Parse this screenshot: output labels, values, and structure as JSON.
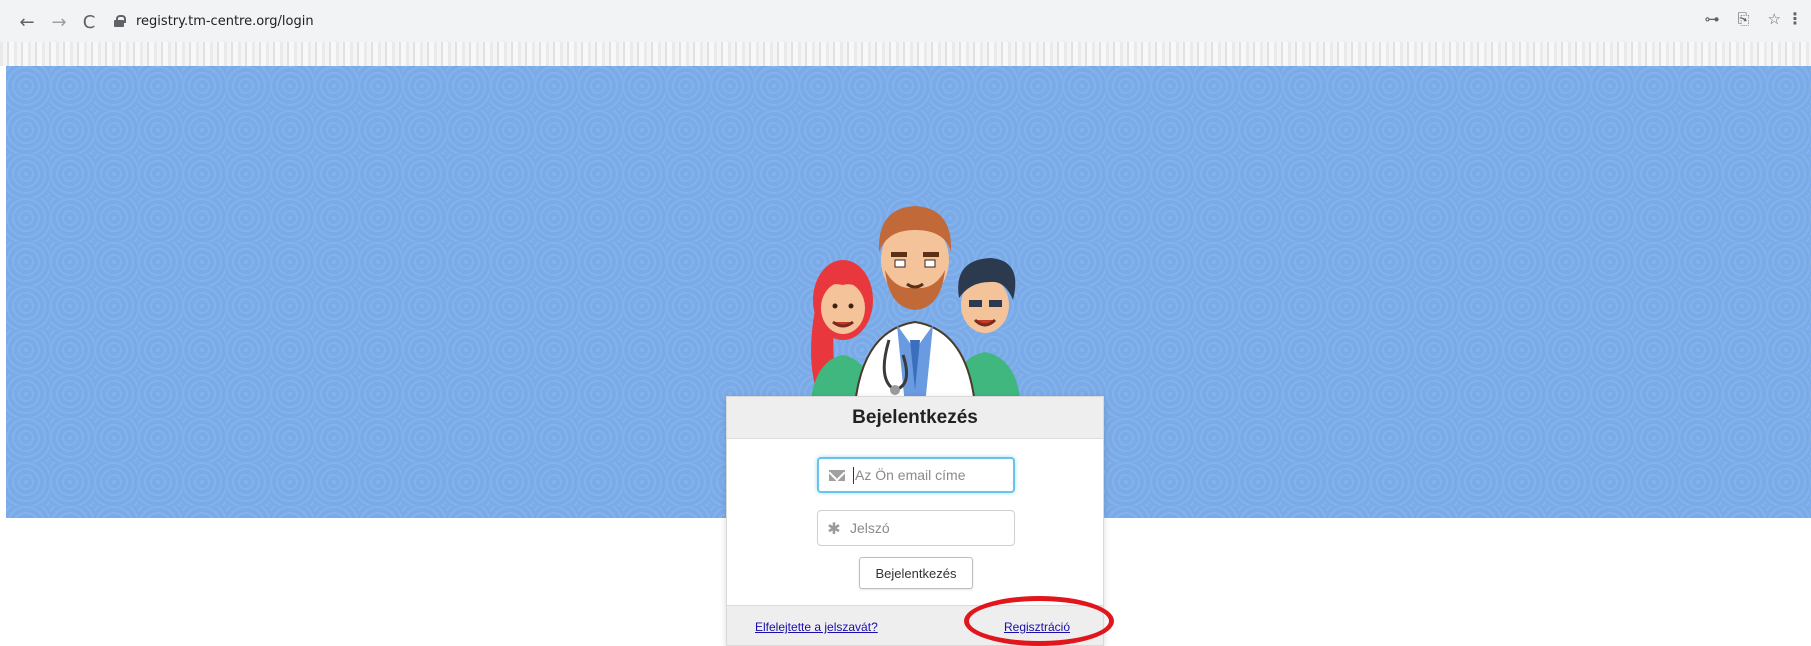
{
  "browser": {
    "url": "registry.tm-centre.org/login",
    "back_icon": "←",
    "forward_icon": "→",
    "reload_icon": "C",
    "key_icon": "⊶",
    "translate_icon": "⎘",
    "star_icon": "☆",
    "menu_icon": "⋮"
  },
  "login": {
    "title": "Bejelentkezés",
    "email_placeholder": "Az Ön email címe",
    "password_placeholder": "Jelszó",
    "submit_label": "Bejelentkezés",
    "forgot_link": "Elfelejtette a jelszavát?",
    "register_link": "Regisztráció"
  },
  "colors": {
    "hero_background": "#7aabe8",
    "focus_border": "#66c4e8",
    "link": "#1a0dab",
    "highlight": "#e0161c"
  }
}
